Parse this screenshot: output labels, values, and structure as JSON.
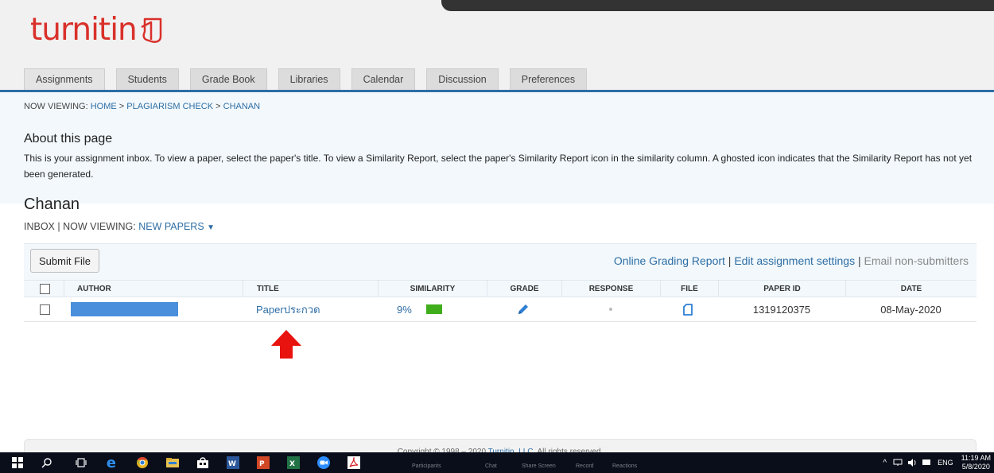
{
  "app": {
    "logo_text": "turnitin"
  },
  "tabs": [
    {
      "label": "Assignments"
    },
    {
      "label": "Students"
    },
    {
      "label": "Grade Book"
    },
    {
      "label": "Libraries"
    },
    {
      "label": "Calendar"
    },
    {
      "label": "Discussion"
    },
    {
      "label": "Preferences"
    }
  ],
  "breadcrumb": {
    "prefix": "NOW VIEWING: ",
    "home": "HOME",
    "sep1": " > ",
    "check": "PLAGIARISM CHECK",
    "sep2": " > ",
    "current": "CHANAN"
  },
  "about": {
    "title": "About this page",
    "text": "This is your assignment inbox. To view a paper, select the paper's title. To view a Similarity Report, select the paper's Similarity Report icon in the similarity column. A ghosted icon indicates that the Similarity Report has not yet been generated."
  },
  "assignment": {
    "title": "Chanan",
    "inbox_prefix": "INBOX | NOW VIEWING: ",
    "view_label": "NEW PAPERS",
    "dropdown_glyph": "▼"
  },
  "toolbar": {
    "submit_label": "Submit File",
    "grading_report": "Online Grading Report",
    "sep": " | ",
    "edit_settings": "Edit assignment settings",
    "email_nonsubmitters": "Email non-submitters"
  },
  "table": {
    "columns": [
      "AUTHOR",
      "TITLE",
      "SIMILARITY",
      "GRADE",
      "RESPONSE",
      "FILE",
      "PAPER ID",
      "DATE"
    ],
    "rows": [
      {
        "title": "Paperประกวด",
        "similarity": "9%",
        "similarity_color": "#3fae1a",
        "paper_id": "1319120375",
        "date": "08-May-2020"
      }
    ]
  },
  "footer": {
    "copyright_prefix": "Copyright © 1998 – 2020 ",
    "company": "Turnitin, LLC",
    "copyright_suffix": ". All rights reserved."
  },
  "taskbar": {
    "zoom_items": [
      "Participants",
      "Chat",
      "Share Screen",
      "Record",
      "Reactions"
    ],
    "language": "ENG",
    "time": "11:19 AM",
    "date": "5/8/2020"
  },
  "colors": {
    "brand_red": "#d9302a",
    "link_blue": "#2e6ea5",
    "annotation_arrow": "#e8130e"
  }
}
